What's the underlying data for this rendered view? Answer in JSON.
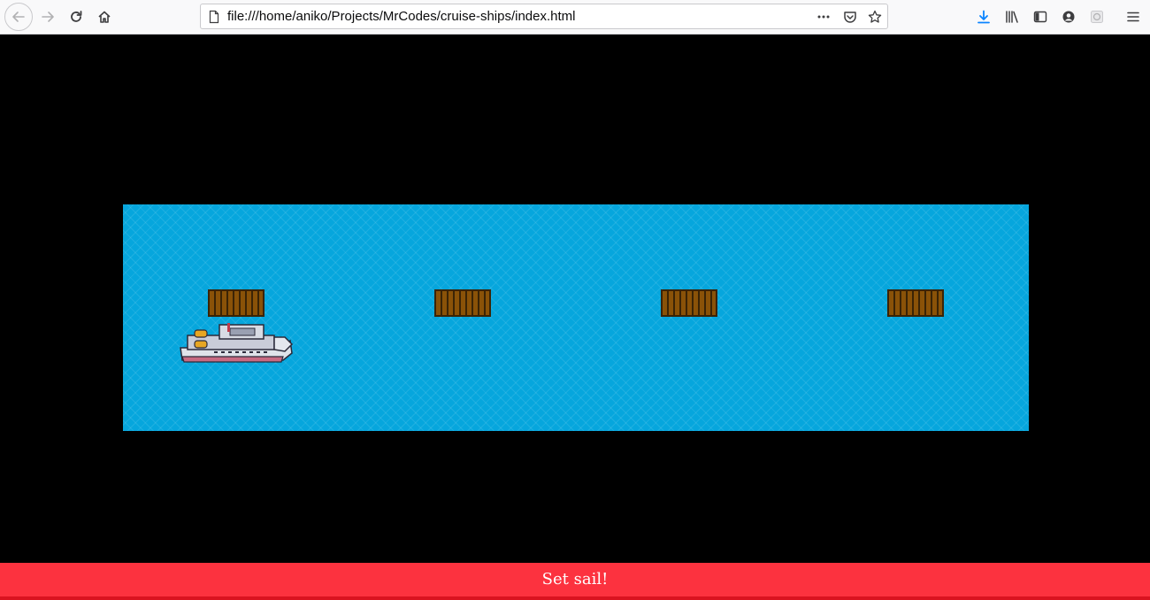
{
  "browser": {
    "url": "file:///home/aniko/Projects/MrCodes/cruise-ships/index.html",
    "buttons": {
      "back": "back-icon",
      "forward": "forward-icon",
      "reload": "reload-icon",
      "home": "home-icon",
      "page_actions": "more-icon",
      "pocket": "pocket-icon",
      "bookmark": "star-icon",
      "downloads": "download-icon",
      "library": "library-icon",
      "sidebar": "sidebar-icon",
      "account": "account-icon",
      "extension": "extension-icon",
      "menu": "menu-icon"
    },
    "accent_color": "#0a84ff"
  },
  "game": {
    "background_color": "#000000",
    "ocean_color": "#06a6dd",
    "ports_count": 4,
    "ship_at_port": 1,
    "start_button": {
      "label": "Set sail!",
      "color": "#fc323f"
    }
  }
}
